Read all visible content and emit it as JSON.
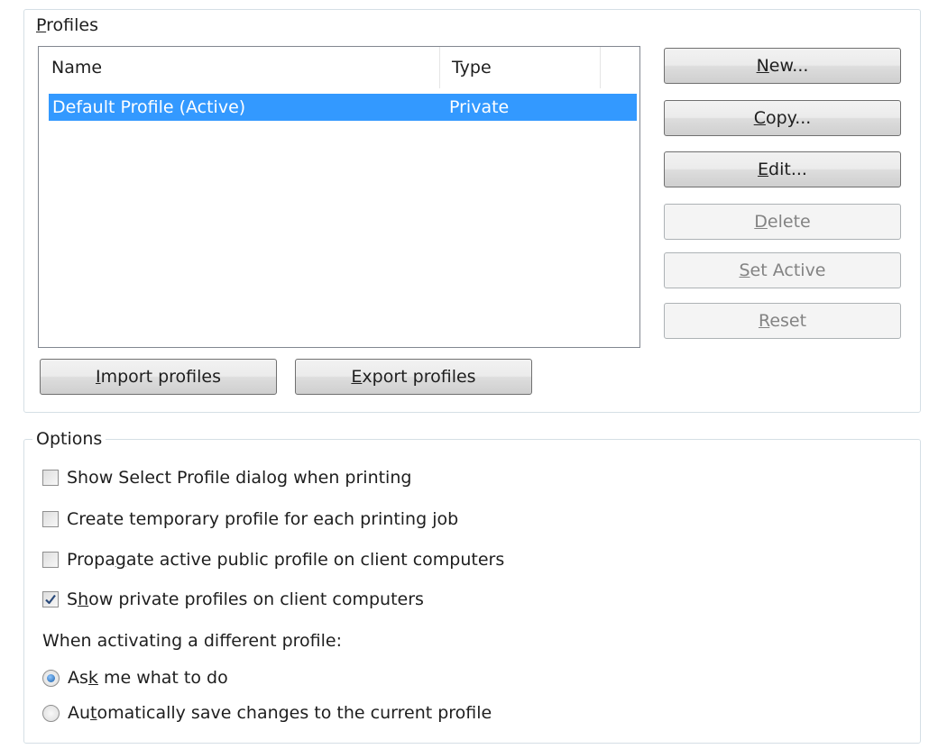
{
  "profiles_group": {
    "title_prefix": "P",
    "title_rest": "rofiles",
    "columns": {
      "name": "Name",
      "type": "Type"
    },
    "rows": [
      {
        "name": "Default Profile (Active)",
        "type": "Private",
        "selected": true
      }
    ],
    "buttons": {
      "new": {
        "mnemonic": "N",
        "rest": "ew..."
      },
      "copy": {
        "mnemonic": "C",
        "rest": "opy..."
      },
      "edit": {
        "mnemonic": "E",
        "rest": "dit..."
      },
      "delete": {
        "mnemonic": "D",
        "rest": "elete"
      },
      "set_active": {
        "mnemonic": "S",
        "rest": "et Active"
      },
      "reset": {
        "mnemonic": "R",
        "rest": "eset"
      },
      "import": {
        "mnemonic": "I",
        "rest": "mport profiles"
      },
      "export": {
        "mnemonic": "E",
        "rest": "xport profiles"
      }
    }
  },
  "options_group": {
    "title": "Options",
    "checkboxes": [
      {
        "label": "Show Select Profile dialog when printing",
        "checked": false
      },
      {
        "label": "Create temporary profile for each printing job",
        "checked": false
      },
      {
        "label_before": "Propa",
        "label_mnemonic": "g",
        "label_after": "ate active public profile on client computers",
        "checked": false
      },
      {
        "label_before": "S",
        "label_mnemonic": "h",
        "label_after": "ow private profiles on client computers",
        "checked": true
      }
    ],
    "activation_label": "When activating a different profile:",
    "radios": [
      {
        "label_before": "As",
        "label_mnemonic": "k",
        "label_after": " me what to do",
        "selected": true
      },
      {
        "label_before": "Au",
        "label_mnemonic": "t",
        "label_after": "omatically save changes to the current profile",
        "selected": false
      }
    ]
  },
  "colors": {
    "selection": "#3399ff",
    "groupbox_border": "#d5dfe5",
    "disabled_text": "#838383",
    "checkmark": "#2a4a7a"
  }
}
